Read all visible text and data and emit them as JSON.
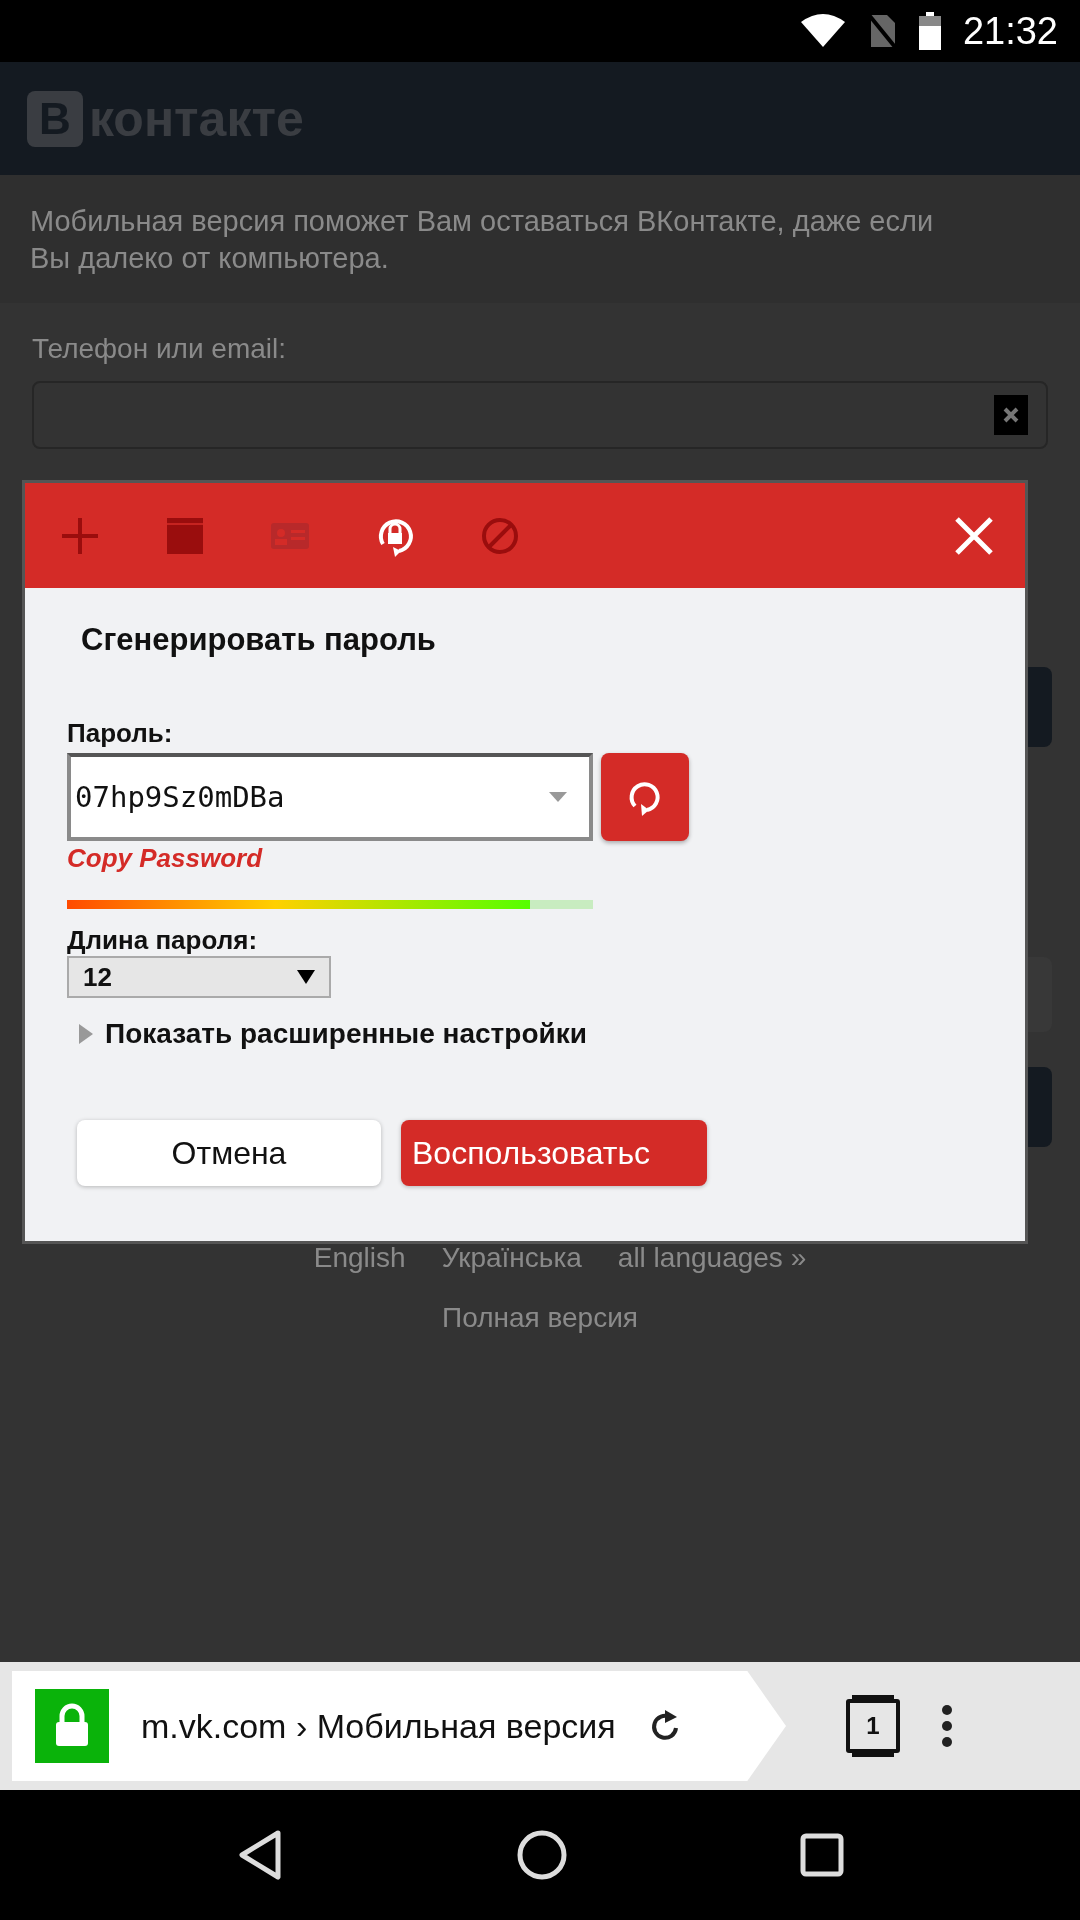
{
  "status_bar": {
    "time": "21:32"
  },
  "page": {
    "logo_letter": "В",
    "logo_text": "контакте",
    "intro": "Мобильная версия поможет Вам оставаться ВКонтакте, даже если Вы далеко от компьютера.",
    "login_label": "Телефон или email:",
    "languages": [
      "English",
      "Українська",
      "all languages »"
    ],
    "full_version": "Полная версия"
  },
  "dialog": {
    "tools": [
      {
        "kind": "add",
        "selected": false,
        "disabled": false
      },
      {
        "kind": "window",
        "selected": false,
        "disabled": false
      },
      {
        "kind": "card",
        "selected": false,
        "disabled": true
      },
      {
        "kind": "generate",
        "selected": true,
        "disabled": false
      },
      {
        "kind": "block",
        "selected": false,
        "disabled": false
      }
    ],
    "title": "Сгенерировать пароль",
    "password_label": "Пароль:",
    "password": "07hp9Sz0mDBa",
    "copy_link": "Copy Password",
    "strength": {
      "level": 0.88
    },
    "length_label": "Длина пароля:",
    "length": "12",
    "advanced": {
      "label": "Показать расширенные настройки",
      "expanded": false
    },
    "buttons": [
      {
        "kind": "cancel",
        "label": "Отмена"
      },
      {
        "kind": "primary",
        "label": "Воспользоватьс"
      }
    ]
  },
  "browser": {
    "url": "m.vk.com › Мобильная версия",
    "secure": true,
    "tab_count": "1"
  }
}
